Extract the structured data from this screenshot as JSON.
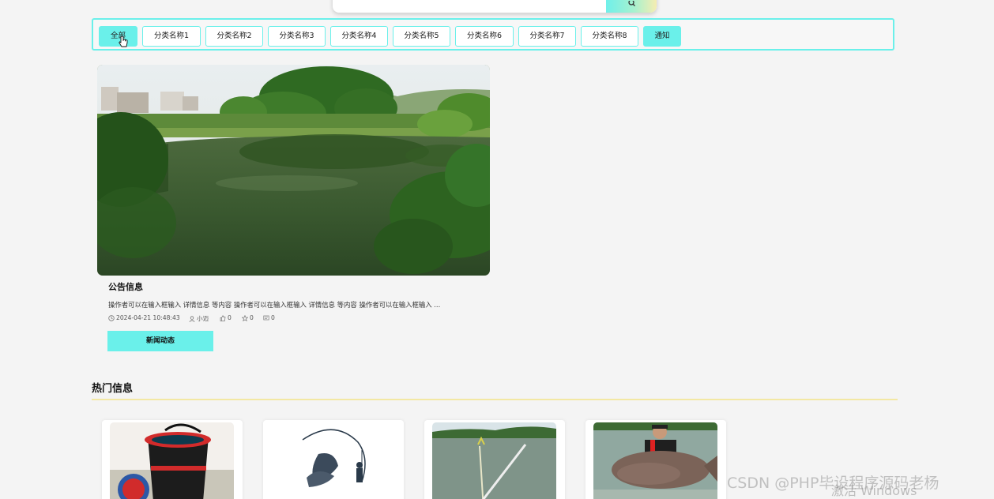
{
  "search": {
    "button_icon": "search-icon"
  },
  "categories": [
    {
      "label": "全部",
      "active": true
    },
    {
      "label": "分类名称1",
      "active": false
    },
    {
      "label": "分类名称2",
      "active": false
    },
    {
      "label": "分类名称3",
      "active": false
    },
    {
      "label": "分类名称4",
      "active": false
    },
    {
      "label": "分类名称5",
      "active": false
    },
    {
      "label": "分类名称6",
      "active": false
    },
    {
      "label": "分类名称7",
      "active": false
    },
    {
      "label": "分类名称8",
      "active": false
    },
    {
      "label": "通知",
      "active": true
    }
  ],
  "featured": {
    "title": "公告信息",
    "description": "操作者可以在输入框输入 详情信息 等内容 操作者可以在输入框输入 详情信息 等内容 操作者可以在输入框输入 ...",
    "datetime": "2024-04-21 10:48:43",
    "author": "小迈",
    "likes": "0",
    "favorites": "0",
    "comments": "0",
    "button_label": "新闻动态"
  },
  "hot": {
    "title": "热门信息"
  },
  "watermark": {
    "csdn": "CSDN @PHP毕设程序源码老杨",
    "windows": "激活 Windows"
  },
  "colors": {
    "accent": "#6af0ea",
    "hot_underline": "#f3e8a3",
    "background": "#f4f4f4"
  }
}
